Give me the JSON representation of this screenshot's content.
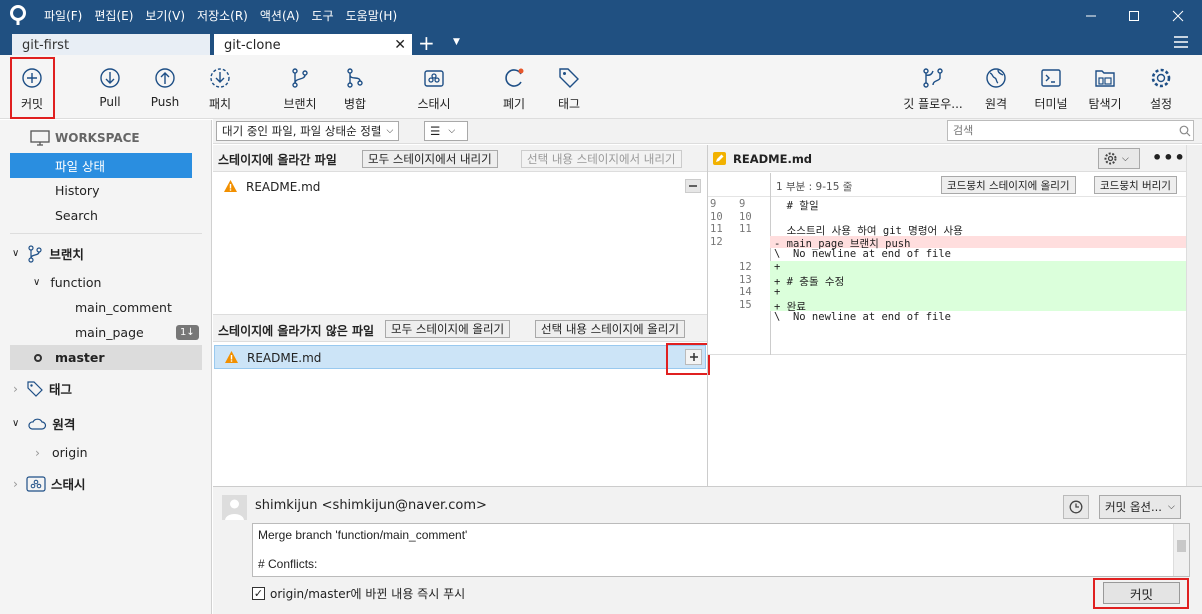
{
  "menu": [
    "파일(F)",
    "편집(E)",
    "보기(V)",
    "저장소(R)",
    "액션(A)",
    "도구",
    "도움말(H)"
  ],
  "tabs": [
    {
      "label": "git-first"
    },
    {
      "label": "git-clone"
    }
  ],
  "toolbar": {
    "commit": "커밋",
    "pull": "Pull",
    "push": "Push",
    "patch": "패치",
    "branch": "브랜치",
    "merge": "병합",
    "stash": "스태시",
    "discard": "폐기",
    "tag": "태그",
    "gitflow": "깃 플로우...",
    "remote": "원격",
    "terminal": "터미널",
    "explorer": "탐색기",
    "settings": "설정"
  },
  "sidebar": {
    "workspace": "WORKSPACE",
    "file_status": "파일 상태",
    "history": "History",
    "search": "Search",
    "branches": "브랜치",
    "function": "function",
    "main_comment": "main_comment",
    "main_page": "main_page",
    "main_page_badge": "1↓",
    "master": "master",
    "tags": "태그",
    "remotes": "원격",
    "origin": "origin",
    "stashes": "스태시"
  },
  "filter": {
    "sort": "대기 중인 파일, 파일 상태순 정렬",
    "view": "☰",
    "search_placeholder": "검색"
  },
  "staged": {
    "title": "스테이지에 올라간 파일",
    "unstage_all": "모두 스테이지에서 내리기",
    "unstage_selected": "선택 내용 스테이지에서 내리기",
    "file": "README.md"
  },
  "unstaged": {
    "title": "스테이지에 올라가지 않은 파일",
    "stage_all": "모두 스테이지에 올리기",
    "stage_selected": "선택 내용 스테이지에 올리기",
    "file": "README.md"
  },
  "diff": {
    "file": "README.md",
    "hunk": "1 부분 : 9-15 줄",
    "stage_hunk": "코드뭉치 스테이지에 올리기",
    "discard_hunk": "코드뭉치 버리기",
    "lines": [
      {
        "o": "9",
        "n": "9",
        "t": "  # 할일",
        "k": "ctx"
      },
      {
        "o": "10",
        "n": "10",
        "t": "",
        "k": "ctx"
      },
      {
        "o": "11",
        "n": "11",
        "t": "  소스트리 사용 하여 git 명령어 사용",
        "k": "ctx"
      },
      {
        "o": "12",
        "n": "",
        "t": "- main_page 브랜치 push",
        "k": "del"
      },
      {
        "o": "",
        "n": "",
        "t": "\\  No newline at end of file",
        "k": "ctx"
      },
      {
        "o": "",
        "n": "12",
        "t": "+",
        "k": "add"
      },
      {
        "o": "",
        "n": "13",
        "t": "+ # 충돌 수정",
        "k": "add"
      },
      {
        "o": "",
        "n": "14",
        "t": "+",
        "k": "add"
      },
      {
        "o": "",
        "n": "15",
        "t": "+ 완료",
        "k": "add"
      },
      {
        "o": "",
        "n": "",
        "t": "\\  No newline at end of file",
        "k": "ctx"
      }
    ]
  },
  "commit": {
    "author": "shimkijun <shimkijun@naver.com>",
    "options": "커밋 옵션...",
    "message_line1": "Merge branch 'function/main_comment'",
    "message_line2": "# Conflicts:",
    "push_label": "origin/master에 바뀐 내용 즉시 푸시",
    "commit_button": "커밋"
  },
  "colors": {
    "titlebar": "#205081",
    "highlight": "#e02020",
    "selection": "#2a8ee0"
  }
}
